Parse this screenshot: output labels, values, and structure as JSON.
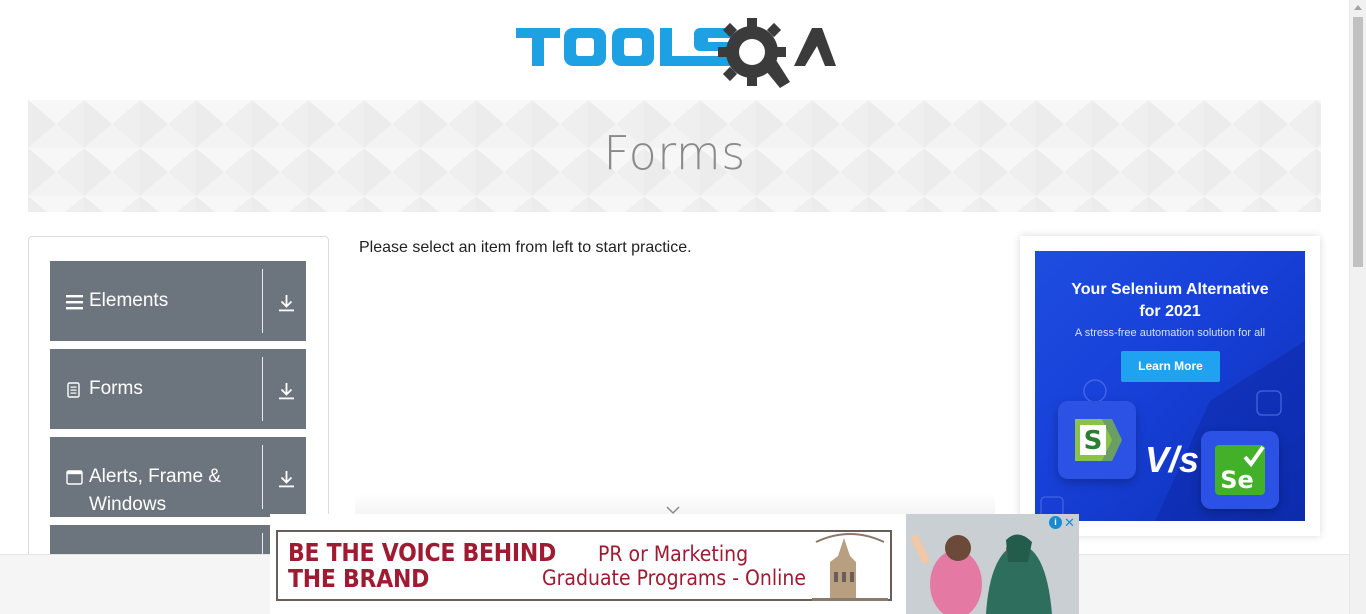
{
  "brand": {
    "logo_text": "TOOLSQA",
    "logo_blue": "#1da1e2",
    "logo_dark": "#3b3b3b"
  },
  "banner": {
    "title": "Forms"
  },
  "sidebar": {
    "groups": [
      {
        "label_line1": "Elements",
        "label_line2": "",
        "icon": "hamburger-icon"
      },
      {
        "label_line1": "Forms",
        "label_line2": "",
        "icon": "document-icon"
      },
      {
        "label_line1": "Alerts, Frame &",
        "label_line2": "Windows",
        "icon": "window-icon"
      },
      {
        "label_line1": "",
        "label_line2": "",
        "icon": ""
      }
    ],
    "group_bg": "#6c757d"
  },
  "main": {
    "instruction": "Please select an item from left to start practice."
  },
  "side_ad": {
    "headline_line1": "Your Selenium Alternative",
    "headline_line2": "for 2021",
    "subline": "A stress-free automation solution for all",
    "button": "Learn More",
    "vs_text": "V/s",
    "tile_s_letter": "S",
    "tile_se_letter": "Se"
  },
  "bottom_ad": {
    "left_line1": "BE THE VOICE BEHIND",
    "left_line2": "THE BRAND",
    "right_line1": "PR or Marketing",
    "right_line2": "Graduate Programs - Online",
    "info_glyph": "i",
    "close_glyph": "✕"
  }
}
